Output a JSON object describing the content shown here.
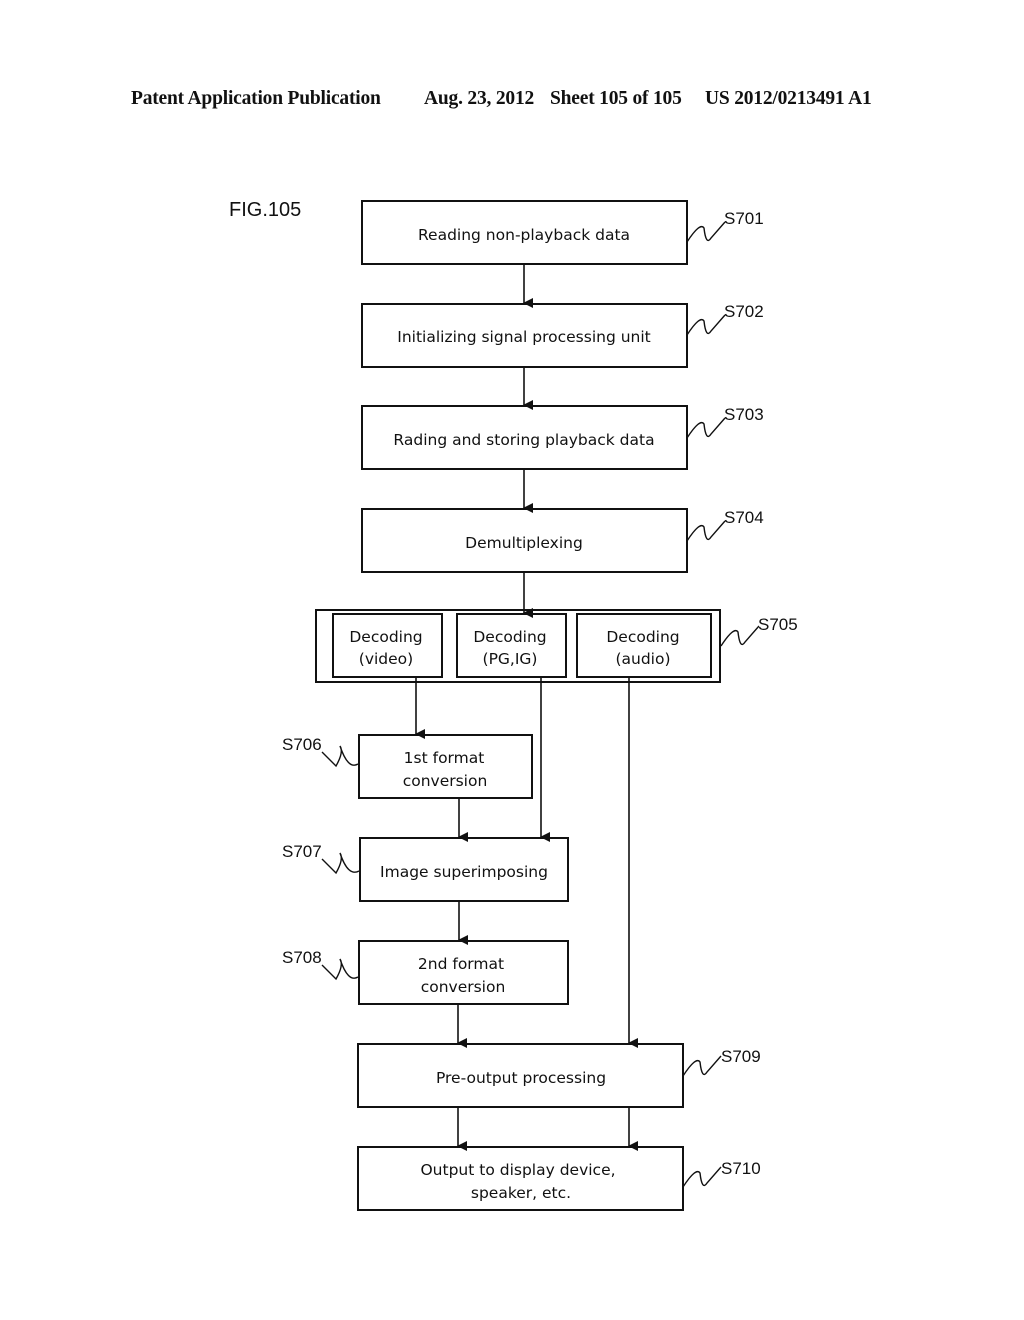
{
  "header": {
    "publication": "Patent Application Publication",
    "date": "Aug. 23, 2012",
    "sheet": "Sheet 105 of 105",
    "number": "US 2012/0213491 A1"
  },
  "figure": {
    "label": "FIG.105",
    "steps": [
      {
        "id": "S701",
        "lines": [
          "Reading non-playback data"
        ]
      },
      {
        "id": "S702",
        "lines": [
          "Initializing signal processing unit"
        ]
      },
      {
        "id": "S703",
        "lines": [
          "Rading and storing playback data"
        ]
      },
      {
        "id": "S704",
        "lines": [
          "Demultiplexing"
        ]
      },
      {
        "id": "S705",
        "substeps": [
          {
            "lines": [
              "Decoding",
              "(video)"
            ]
          },
          {
            "lines": [
              "Decoding",
              "(PG,IG)"
            ]
          },
          {
            "lines": [
              "Decoding",
              "(audio)"
            ]
          }
        ]
      },
      {
        "id": "S706",
        "lines": [
          "1st format",
          "conversion"
        ]
      },
      {
        "id": "S707",
        "lines": [
          "Image superimposing"
        ]
      },
      {
        "id": "S708",
        "lines": [
          "2nd format",
          "conversion"
        ]
      },
      {
        "id": "S709",
        "lines": [
          "Pre-output processing"
        ]
      },
      {
        "id": "S710",
        "lines": [
          "Output to display device,",
          "speaker, etc."
        ]
      }
    ],
    "connections": [
      [
        "S701",
        "S702"
      ],
      [
        "S702",
        "S703"
      ],
      [
        "S703",
        "S704"
      ],
      [
        "S704",
        "S705"
      ],
      [
        "S705-video",
        "S706"
      ],
      [
        "S706",
        "S707"
      ],
      [
        "S705-PG,IG",
        "S707"
      ],
      [
        "S707",
        "S708"
      ],
      [
        "S708",
        "S709"
      ],
      [
        "S705-audio",
        "S709"
      ],
      [
        "S709",
        "S710"
      ]
    ]
  }
}
